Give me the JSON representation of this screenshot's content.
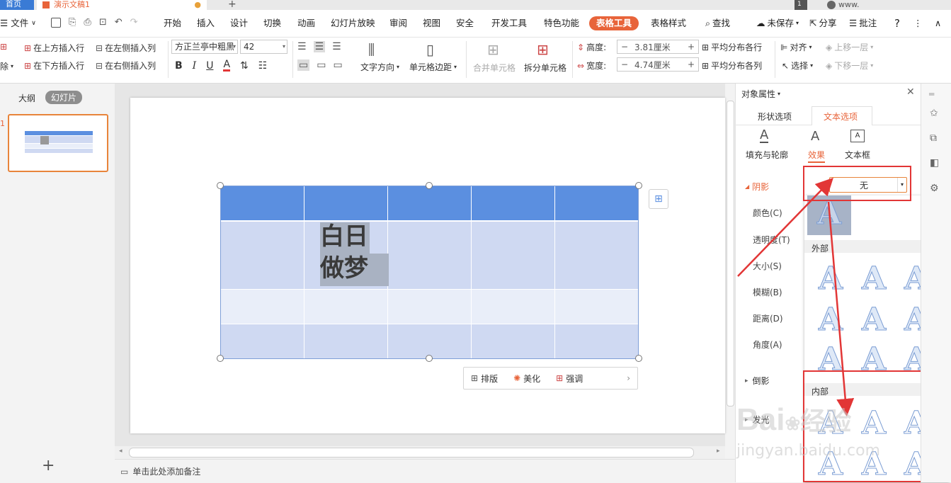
{
  "titlebar": {
    "home_tab": "首页",
    "doc_tab": "演示文稿1",
    "new_tab": "+",
    "badge": "1",
    "user": "www."
  },
  "menu": {
    "file": "文件",
    "items": [
      "开始",
      "插入",
      "设计",
      "切换",
      "动画",
      "幻灯片放映",
      "审阅",
      "视图",
      "安全",
      "开发工具",
      "特色功能"
    ],
    "active": "表格工具",
    "after": "表格样式",
    "search": "查找",
    "unsaved": "未保存",
    "share": "分享",
    "comment": "批注",
    "help": "?"
  },
  "ribbon": {
    "insert_above": "在上方插入行",
    "insert_left": "在左侧插入列",
    "insert_below": "在下方插入行",
    "insert_right": "在右侧插入列",
    "delete": "除",
    "font_name": "方正兰亭中粗黑",
    "font_size": "42",
    "text_direction": "文字方向",
    "cell_margin": "单元格边距",
    "merge_cells": "合并单元格",
    "split_cells": "拆分单元格",
    "height_label": "高度:",
    "height_value": "3.81厘米",
    "width_label": "宽度:",
    "width_value": "4.74厘米",
    "dist_rows": "平均分布各行",
    "dist_cols": "平均分布各列",
    "align": "对齐",
    "select": "选择",
    "bring_forward": "上移一层",
    "send_backward": "下移一层"
  },
  "left_panel": {
    "outline_tab": "大纲",
    "slides_tab": "幻灯片",
    "slide_number": "1",
    "add_slide": "+"
  },
  "table": {
    "text_line1": "白日",
    "text_line2": "做梦",
    "colors": {
      "header": "#5b8fe0",
      "row_dark": "#cfd9f2",
      "row_light": "#e9eef9"
    }
  },
  "float_toolbar": {
    "layout": "排版",
    "beautify": "美化",
    "emphasize": "强调"
  },
  "notes": {
    "placeholder": "单击此处添加备注"
  },
  "right_panel": {
    "title": "对象属性",
    "tab_shape": "形状选项",
    "tab_text": "文本选项",
    "sub_fill": "填充与轮廓",
    "sub_effect": "效果",
    "sub_textbox": "文本框",
    "shadow_section": "阴影",
    "shadow_value": "无",
    "labels": [
      "颜色(C)",
      "透明度(T)",
      "大小(S)",
      "模糊(B)",
      "距离(D)",
      "角度(A)"
    ],
    "reflection": "倒影",
    "glow": "发光"
  },
  "dropdown": {
    "outer_header": "外部",
    "inner_header": "内部"
  },
  "watermark": {
    "brand": "Bai",
    "brand2": "经验",
    "url": "jingyan.baidu.com"
  },
  "accent_color": "#e8643a"
}
